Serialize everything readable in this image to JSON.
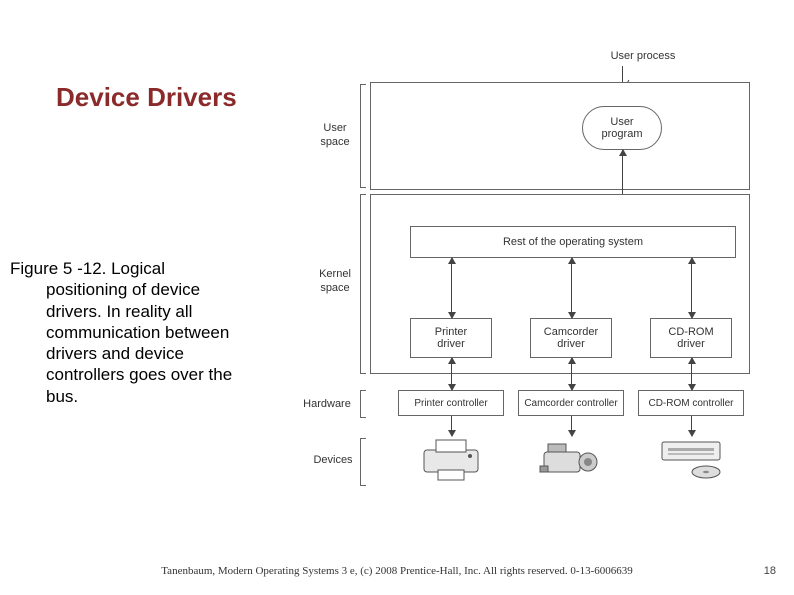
{
  "title": "Device Drivers",
  "caption_first": "Figure 5 -12. Logical",
  "caption_rest": "positioning of device drivers. In reality all communication between drivers and device controllers goes over the bus.",
  "footer": "Tanenbaum, Modern Operating Systems 3 e, (c) 2008 Prentice-Hall, Inc. All rights reserved. 0-13-6006639",
  "page_number": "18",
  "diagram": {
    "top_label": "User process",
    "side": {
      "user_space": "User\nspace",
      "kernel_space": "Kernel\nspace",
      "hardware": "Hardware",
      "devices": "Devices"
    },
    "user_program": "User\nprogram",
    "rest_os": "Rest of the operating system",
    "drivers": [
      "Printer\ndriver",
      "Camcorder\ndriver",
      "CD-ROM\ndriver"
    ],
    "controllers": [
      "Printer controller",
      "Camcorder controller",
      "CD-ROM controller"
    ],
    "devices_alt": [
      "printer",
      "camcorder",
      "cd-rom-drive"
    ]
  }
}
